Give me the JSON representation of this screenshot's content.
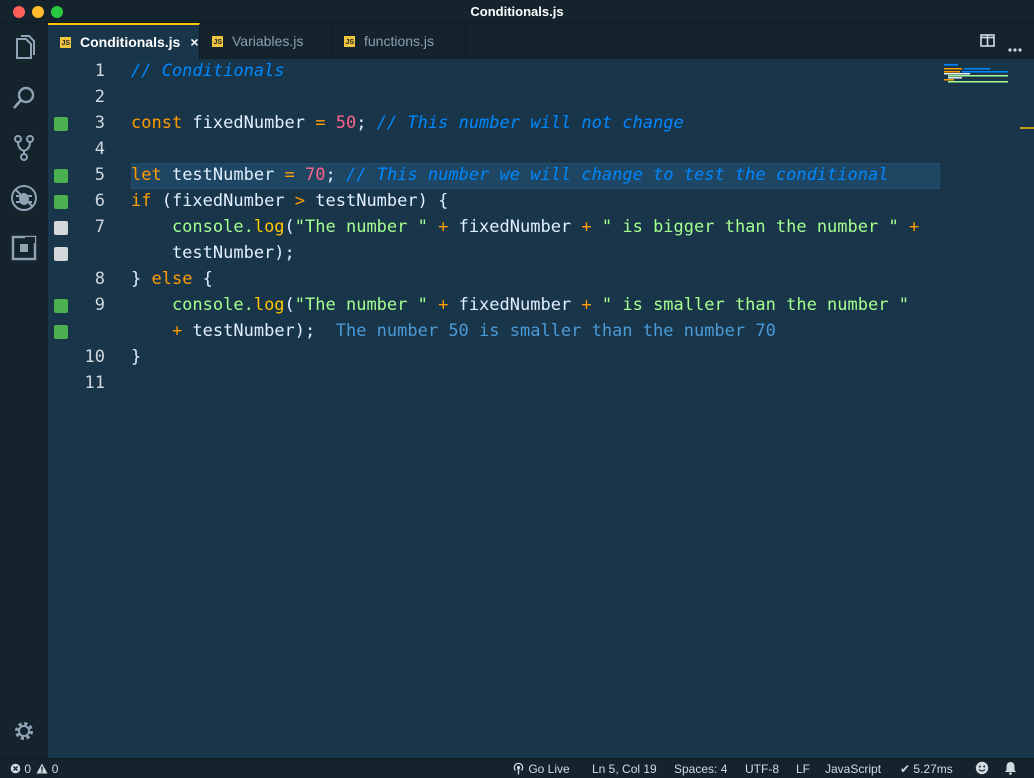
{
  "window": {
    "title": "Conditionals.js"
  },
  "tabs": [
    {
      "label": "Conditionals.js",
      "badge": "JS",
      "active": true,
      "close": "×"
    },
    {
      "label": "Variables.js",
      "badge": "JS"
    },
    {
      "label": "functions.js",
      "badge": "JS"
    }
  ],
  "activity_icons": [
    "files-icon",
    "search-icon",
    "source-control-icon",
    "debug-icon",
    "extensions-icon",
    "settings-gear-icon"
  ],
  "editor": {
    "current_line": 5,
    "lines": [
      {
        "num": "1"
      },
      {
        "num": "2"
      },
      {
        "num": "3",
        "decor": "green"
      },
      {
        "num": "4"
      },
      {
        "num": "5",
        "decor": "green"
      },
      {
        "num": "6",
        "decor": "green"
      },
      {
        "num": "7",
        "decor": "grey"
      },
      {
        "num": "",
        "decor": "grey"
      },
      {
        "num": "8"
      },
      {
        "num": "9",
        "decor": "green"
      },
      {
        "num": "",
        "decor": "green"
      },
      {
        "num": "10"
      },
      {
        "num": "11"
      }
    ],
    "tokens": {
      "l1_comment": "// Conditionals",
      "l3_const": "const",
      "l3_name": " fixedNumber ",
      "l3_eq": "=",
      "l3_num": " 50",
      "l3_semi": "; ",
      "l3_comment": "// This number will not change",
      "l5_let": "let",
      "l5_name": " testNumber ",
      "l5_eq": "=",
      "l5_num": " 70",
      "l5_semi": "; ",
      "l5_comment": "// This number we will change to test the conditional",
      "l6_if": "if",
      "l6_open": " (fixedNumber ",
      "l6_gt": ">",
      "l6_rest": " testNumber) {",
      "l7_console": "    console.",
      "l7_log": "log",
      "l7_paren": "(",
      "l7_str1": "\"The number \"",
      "l7_plus1": " + ",
      "l7_var": "fixedNumber",
      "l7_plus2": " + ",
      "l7_str2": "\" is bigger than the number \"",
      "l7_plus3": " +",
      "l7b_rest": "    testNumber);",
      "l8_close": "} ",
      "l8_else": "else",
      "l8_brace": " {",
      "l9_console": "    console.",
      "l9_log": "log",
      "l9_paren": "(",
      "l9_str1": "\"The number \"",
      "l9_plus1": " + ",
      "l9_var": "fixedNumber",
      "l9_plus2": " + ",
      "l9_str2": "\" is smaller than the number \"",
      "l9b_indent": "    ",
      "l9b_plus": "+",
      "l9b_rest": " testNumber);  ",
      "l9b_result": "The number 50 is smaller than the number 70",
      "l10_close": "}"
    }
  },
  "statusbar": {
    "errors": "0",
    "warnings": "0",
    "go_live": "Go Live",
    "position": "Ln 5, Col 19",
    "spaces": "Spaces: 4",
    "encoding": "UTF-8",
    "eol": "LF",
    "language": "JavaScript",
    "timing": "✔ 5.27ms"
  },
  "colors": {
    "background": "#193549",
    "keyword": "#ff9d00",
    "number": "#ff628c",
    "comment": "#0088ff",
    "string": "#a5ff90",
    "function": "#ffc600"
  }
}
